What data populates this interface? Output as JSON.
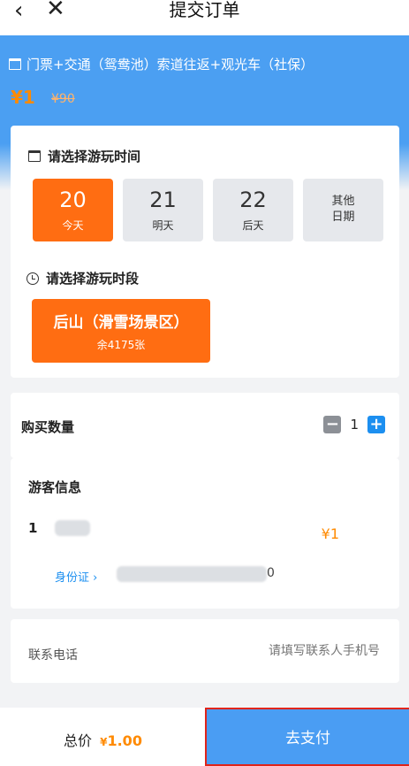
{
  "topbar": {
    "back": "‹",
    "close": "✕",
    "title": "提交订单"
  },
  "product": {
    "name": "门票+交通（鸳鸯池）索道往返+观光车（社保）",
    "price": "¥1",
    "original_price": "¥90"
  },
  "date_section": {
    "title": "请选择游玩时间",
    "dates": [
      {
        "day": "20",
        "label": "今天",
        "selected": true
      },
      {
        "day": "21",
        "label": "明天",
        "selected": false
      },
      {
        "day": "22",
        "label": "后天",
        "selected": false
      }
    ],
    "other": {
      "line1": "其他",
      "line2": "日期"
    }
  },
  "time_section": {
    "title": "请选择游玩时段",
    "slot": {
      "name": "后山（滑雪场景区）",
      "remain": "余4175张"
    }
  },
  "quantity": {
    "label": "购买数量",
    "minus": "−",
    "value": "1",
    "plus": "+"
  },
  "visitor": {
    "title": "游客信息",
    "index": "1",
    "name_tail": "",
    "price": "¥1",
    "id_type": "身份证 ›",
    "id_tail": "0"
  },
  "contact": {
    "label": "联系电话",
    "placeholder": "请填写联系人手机号"
  },
  "footer": {
    "total_label": "总价",
    "currency": "¥",
    "total_amount": "1.00",
    "pay_label": "去支付"
  },
  "colors": {
    "accent": "#ff6d12",
    "brand_blue": "#4a9df3",
    "price": "#ff8a00"
  }
}
